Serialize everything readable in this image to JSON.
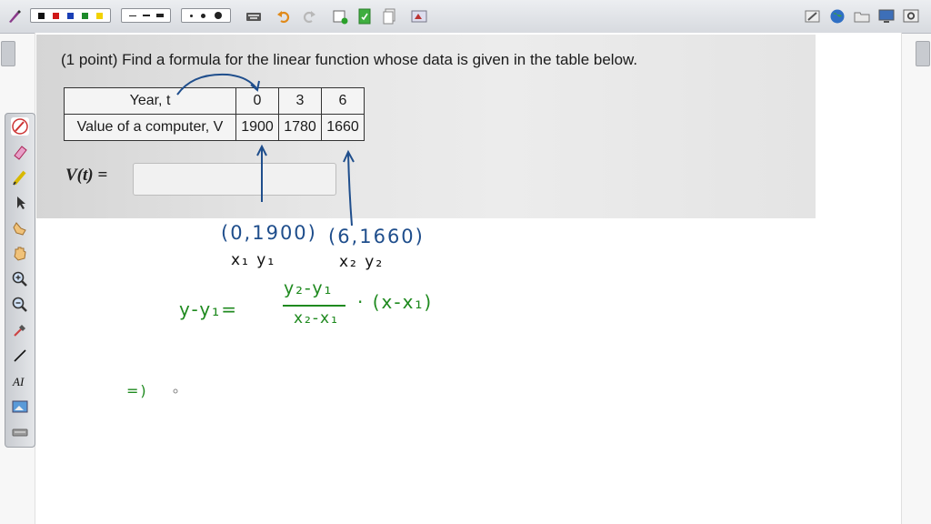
{
  "problem": {
    "prompt": "(1 point) Find a formula for the linear function whose data is given in the table below.",
    "table": {
      "rows": [
        {
          "label": "Year, t",
          "values": [
            "0",
            "3",
            "6"
          ]
        },
        {
          "label": "Value of a computer, V",
          "values": [
            "1900",
            "1780",
            "1660"
          ]
        }
      ]
    },
    "answer_label": "V(t) =",
    "answer_value": ""
  },
  "annotations": {
    "point1": "(0,1900)",
    "point1_vars": "x₁  y₁",
    "point2": "(6,1660)",
    "point2_vars": "x₂  y₂",
    "formula_lhs": "y-y₁=",
    "formula_num": "y₂-y₁",
    "formula_den": "x₂-x₁",
    "formula_rhs": "· (x-x₁)",
    "implies": "=)"
  },
  "colors": {
    "annotation_blue": "#1f4e8c",
    "annotation_green": "#1f8a1f",
    "swatch_black": "#111111",
    "swatch_red": "#d01818",
    "swatch_blue": "#1a3fb5",
    "swatch_green": "#1c8a2a",
    "swatch_yellow": "#f2d200"
  },
  "toolbar_icons": [
    "pen-icon",
    "color-swatches",
    "line-styles",
    "line-widths",
    "keyboard-icon",
    "undo-icon",
    "redo-icon",
    "add-page-icon",
    "document-icon",
    "pages-icon",
    "screenshot-icon",
    "edit-icon",
    "globe-icon",
    "folder-icon",
    "monitor-icon",
    "settings-icon"
  ],
  "palette_icons": [
    "pen-icon",
    "eraser-icon",
    "highlighter-icon",
    "select-arrow-icon",
    "hand-point-icon",
    "hand-pan-icon",
    "zoom-in-icon",
    "zoom-out-icon",
    "eyedropper-icon",
    "line-icon",
    "text-tool-icon",
    "image-icon",
    "keyboard-icon"
  ]
}
